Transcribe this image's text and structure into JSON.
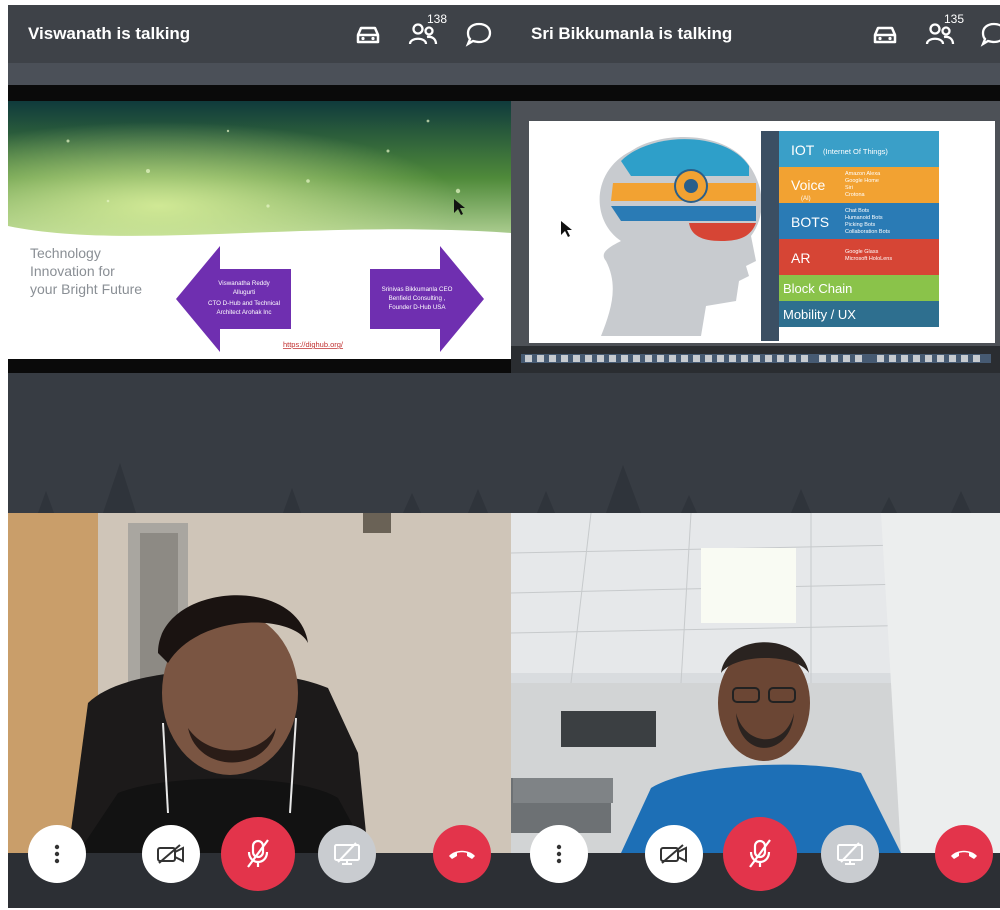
{
  "left": {
    "header": {
      "title": "Viswanath is talking",
      "participant_count": "138"
    },
    "slide": {
      "heading_lines": [
        "Technology",
        "Innovation for",
        "your Bright Future"
      ],
      "left_arrow_lines": [
        "Viswanatha Reddy",
        "Allugurti",
        "CTO D-Hub and Technical",
        "Architect Arohak Inc"
      ],
      "right_arrow_lines": [
        "Srinivas Bikkumanla CEO",
        "Benfield Consulting ,",
        "Founder D-Hub USA"
      ],
      "link": "https://dighub.org/"
    }
  },
  "right": {
    "header": {
      "title": "Sri Bikkumanla is talking",
      "participant_count": "135"
    },
    "slide": {
      "rows": [
        {
          "label": "IOT",
          "sub": "(Internet Of Things)",
          "detail": [],
          "color": "#3a9fc8"
        },
        {
          "label": "Voice",
          "sub": "(AI)",
          "detail": [
            "Amazon Alexa",
            "Google Home",
            "Siri",
            "Crotona"
          ],
          "color": "#f2a232"
        },
        {
          "label": "BOTS",
          "sub": "",
          "detail": [
            "Chat Bots",
            "Humanoid Bots",
            "Picking Bots",
            "Collaboration Bots"
          ],
          "color": "#2a7bb5"
        },
        {
          "label": "AR",
          "sub": "",
          "detail": [
            "Google Glass",
            "Microsoft HoloLens"
          ],
          "color": "#d64535"
        },
        {
          "label": "Block Chain",
          "sub": "",
          "detail": [],
          "color": "#8ac34a"
        },
        {
          "label": "Mobility / UX",
          "sub": "",
          "detail": [],
          "color": "#2e6f8f"
        }
      ]
    }
  },
  "controls": {
    "more": "more-vertical-icon",
    "camera": "camera-off-icon",
    "mic": "mic-off-icon",
    "screen": "screen-share-off-icon",
    "hangup": "hang-up-icon"
  },
  "colors": {
    "header_bg": "#3e4248",
    "danger": "#e3344b"
  }
}
